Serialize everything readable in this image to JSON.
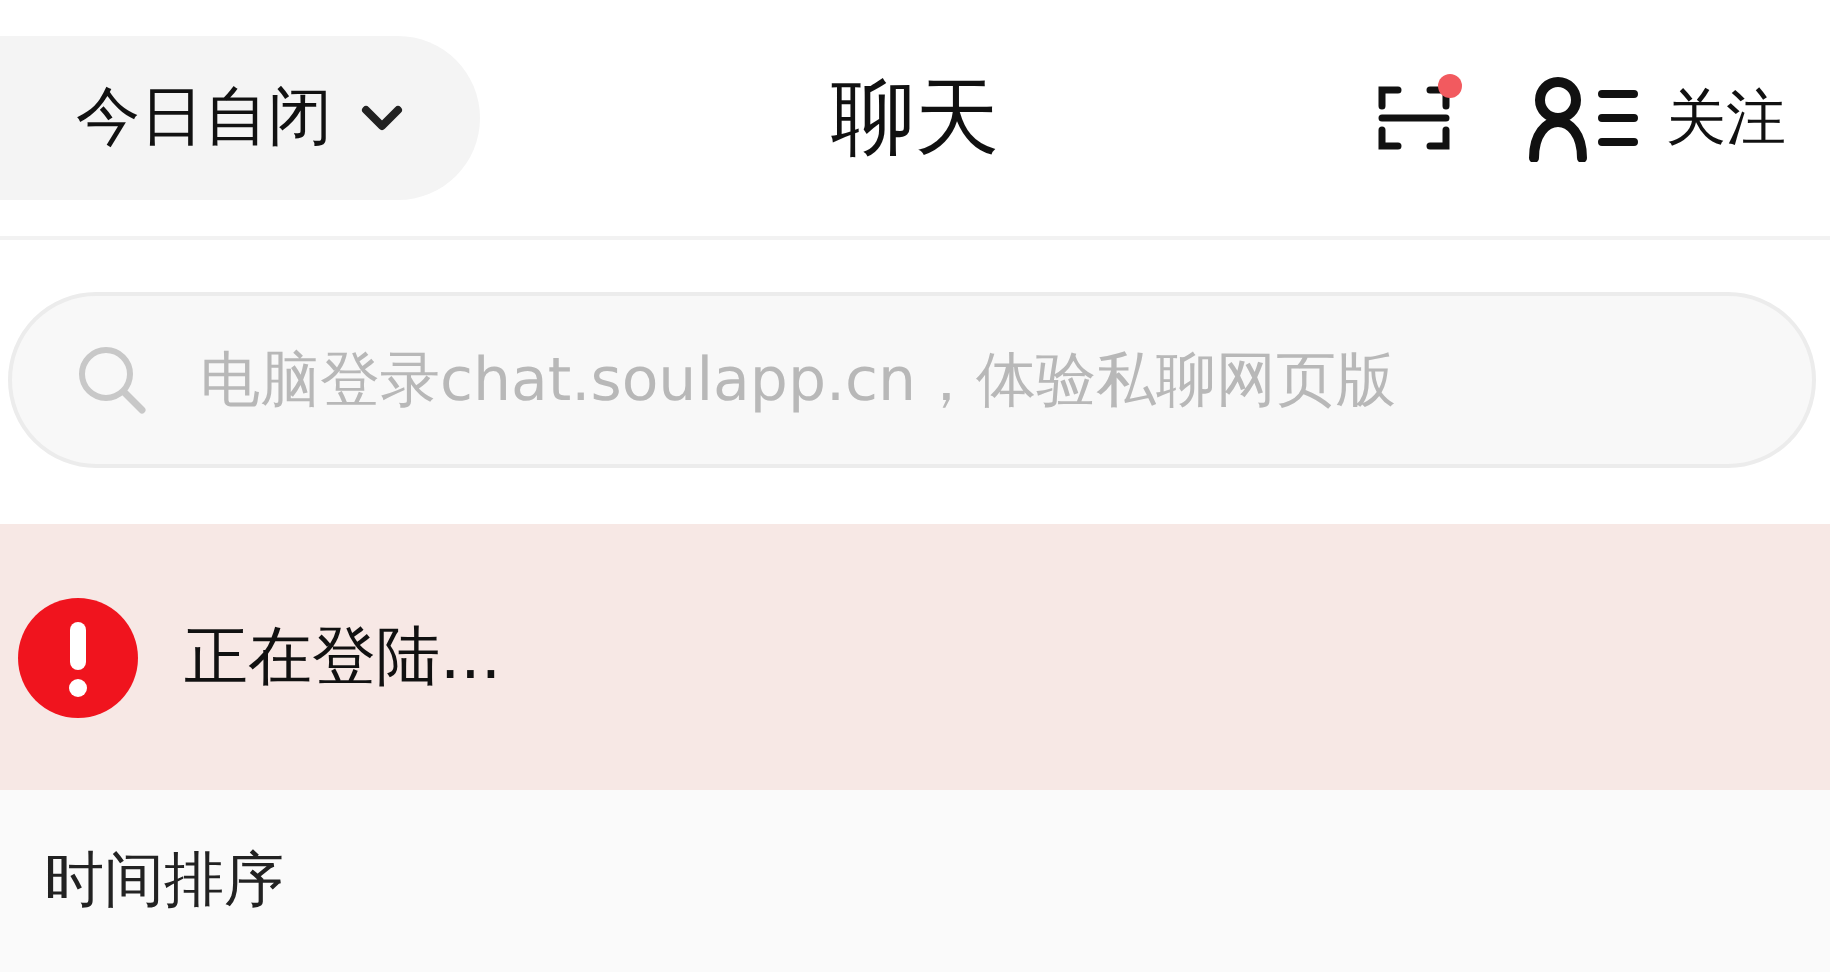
{
  "header": {
    "mode_selector": "今日自闭",
    "title": "聊天",
    "scan_notification": true,
    "follow_label": "关注"
  },
  "search": {
    "placeholder": "电脑登录chat.soulapp.cn，体验私聊网页版"
  },
  "banner": {
    "kind": "error",
    "text": "正在登陆..."
  },
  "sort": {
    "label": "时间排序"
  }
}
